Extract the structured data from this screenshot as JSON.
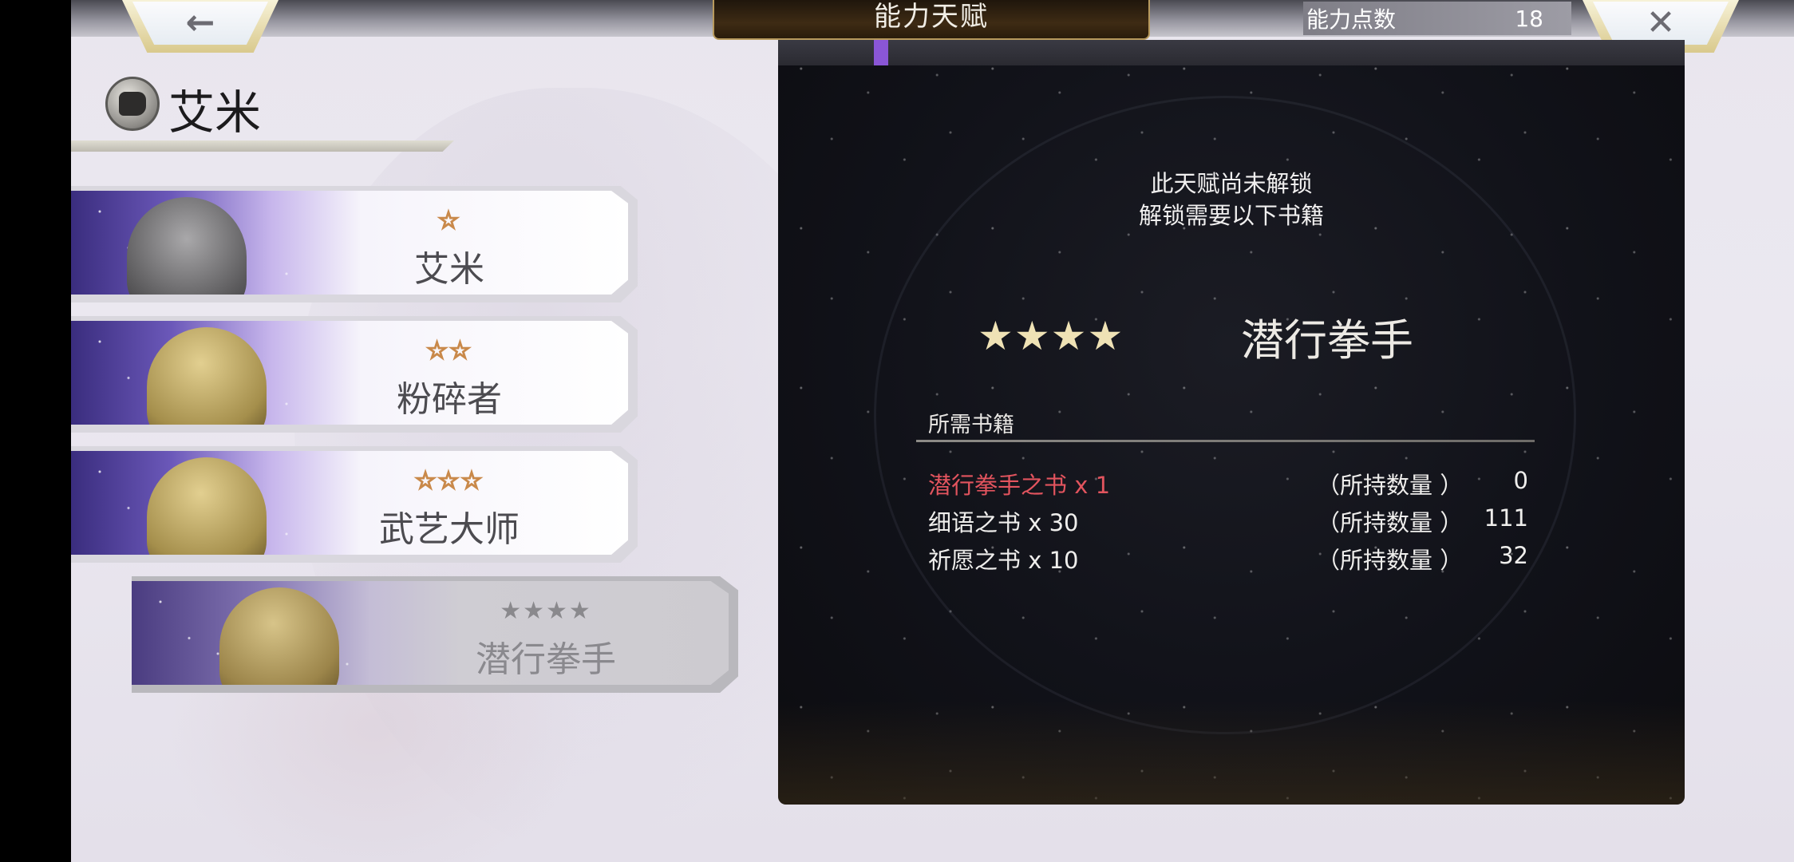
{
  "header": {
    "title": "能力天赋",
    "points_label": "能力点数",
    "points_value": "18",
    "back_icon": "←",
    "close_icon": "✕"
  },
  "character": {
    "name": "艾米"
  },
  "jobs": [
    {
      "stars": "☆",
      "name": "艾米"
    },
    {
      "stars": "☆☆",
      "name": "粉碎者"
    },
    {
      "stars": "☆☆☆",
      "name": "武艺大师"
    },
    {
      "stars": "★★★★",
      "name": "潜行拳手"
    }
  ],
  "detail": {
    "locked_line1": "此天赋尚未解锁",
    "locked_line2": "解锁需要以下书籍",
    "stars": "★★★★",
    "name": "潜行拳手",
    "books_header": "所需书籍",
    "books": [
      {
        "name": "潜行拳手之书 x 1",
        "held_label": "（所持数量 ）",
        "count": "0"
      },
      {
        "name": "细语之书 x 30",
        "held_label": "（所持数量 ）",
        "count": "111"
      },
      {
        "name": "祈愿之书 x 10",
        "held_label": "（所持数量 ）",
        "count": "32"
      }
    ]
  },
  "colors": {
    "missing_book": "#e2545e",
    "accent_purple": "#8a56d6",
    "star_gold": "#efe2b5"
  }
}
